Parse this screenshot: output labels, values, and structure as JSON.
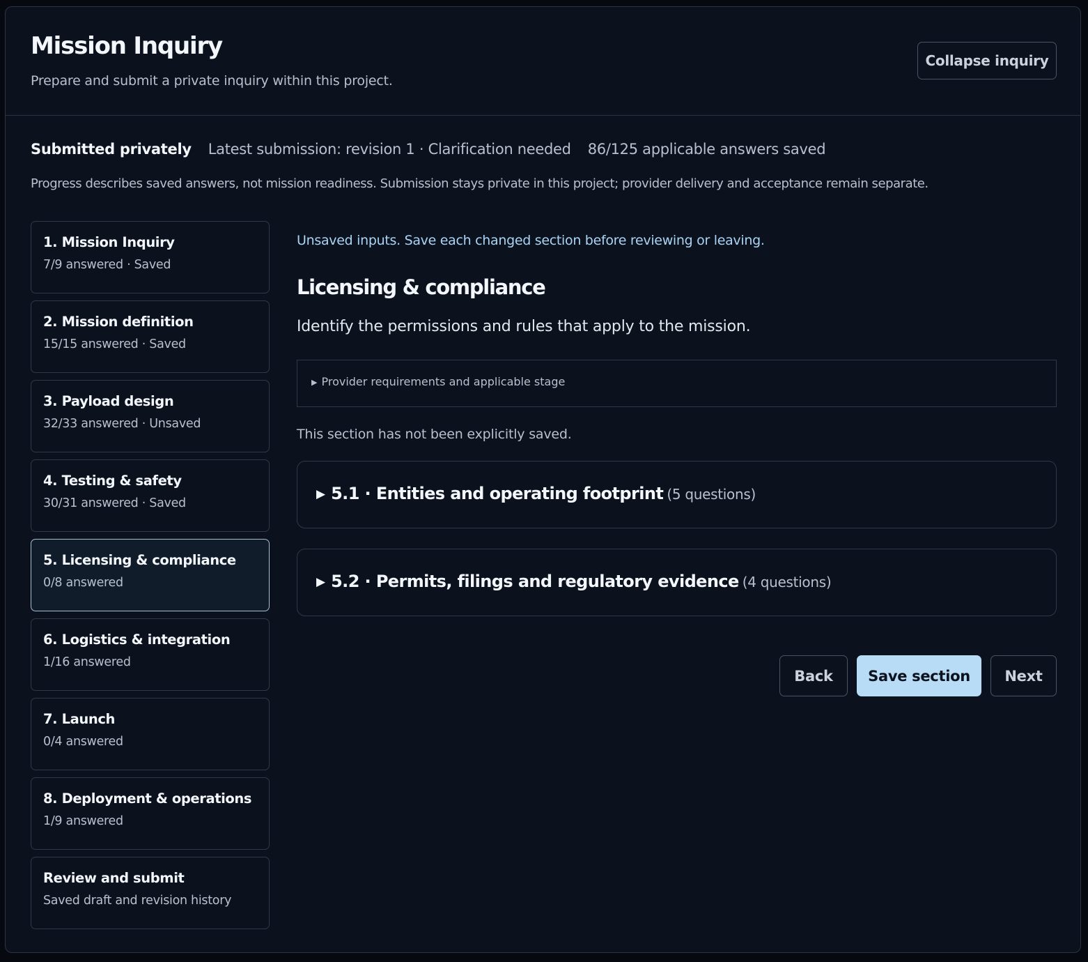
{
  "header": {
    "title": "Mission Inquiry",
    "subtitle": "Prepare and submit a private inquiry within this project.",
    "collapse_label": "Collapse inquiry"
  },
  "status": {
    "state": "Submitted privately",
    "latest": "Latest submission: revision 1 · Clarification needed",
    "progress": "86/125 applicable answers saved",
    "note": "Progress describes saved answers, not mission readiness. Submission stays private in this project; provider delivery and acceptance remain separate."
  },
  "nav": {
    "items": [
      {
        "title": "1. Mission Inquiry",
        "sub": "7/9 answered · Saved"
      },
      {
        "title": "2. Mission definition",
        "sub": "15/15 answered · Saved"
      },
      {
        "title": "3. Payload design",
        "sub": "32/33 answered · Unsaved"
      },
      {
        "title": "4. Testing & safety",
        "sub": "30/31 answered · Saved"
      },
      {
        "title": "5. Licensing & compliance",
        "sub": "0/8 answered",
        "active": true
      },
      {
        "title": "6. Logistics & integration",
        "sub": "1/16 answered"
      },
      {
        "title": "7. Launch",
        "sub": "0/4 answered"
      },
      {
        "title": "8. Deployment & operations",
        "sub": "1/9 answered"
      },
      {
        "title": "Review and submit",
        "sub": "Saved draft and revision history"
      }
    ]
  },
  "main": {
    "warning": "Unsaved inputs. Save each changed section before reviewing or leaving.",
    "section_title": "Licensing & compliance",
    "section_desc": "Identify the permissions and rules that apply to the mission.",
    "provider_label": "Provider requirements and applicable stage",
    "not_saved": "This section has not been explicitly saved.",
    "subsections": [
      {
        "title": "5.1 · Entities and operating footprint",
        "count": "(5 questions)"
      },
      {
        "title": "5.2 · Permits, filings and regulatory evidence",
        "count": "(4 questions)"
      }
    ],
    "buttons": {
      "back": "Back",
      "save": "Save section",
      "next": "Next"
    }
  },
  "icons": {
    "disclosure": "▶"
  },
  "colors": {
    "background": "#0b121d",
    "accent": "#b9dcf6",
    "warning_text": "#a9d4f5",
    "active_border": "#a9bdd1"
  }
}
